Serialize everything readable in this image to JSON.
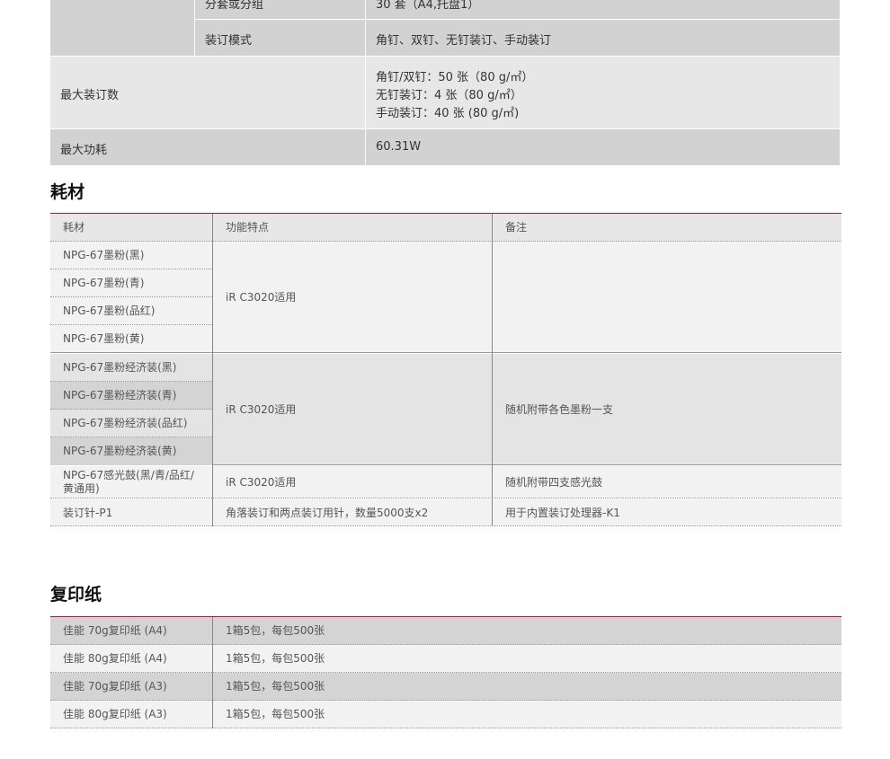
{
  "spec_table": {
    "rows": [
      {
        "sub_label": "分套或分组",
        "value": "30 套（A4,托盘1）"
      },
      {
        "sub_label": "装订模式",
        "value": "角钉、双钉、无钉装订、手动装订"
      },
      {
        "label": "最大装订数",
        "values": [
          "角钉/双钉：50 张（80 g/㎡）",
          "无钉装订：4 张（80 g/㎡）",
          "手动装订：40 张 (80 g/㎡)"
        ]
      },
      {
        "label": "最大功耗",
        "value": "60.31W"
      }
    ]
  },
  "consumables": {
    "title": "耗材",
    "headers": [
      "耗材",
      "功能特点",
      "备注"
    ],
    "group1": {
      "items": [
        "NPG-67墨粉(黑)",
        "NPG-67墨粉(青)",
        "NPG-67墨粉(品红)",
        "NPG-67墨粉(黄)"
      ],
      "feature": "iR C3020适用",
      "note": ""
    },
    "group2": {
      "items": [
        "NPG-67墨粉经济装(黑)",
        "NPG-67墨粉经济装(青)",
        "NPG-67墨粉经济装(品红)",
        "NPG-67墨粉经济装(黄)"
      ],
      "feature": "iR C3020适用",
      "note": "随机附带各色墨粉一支"
    },
    "drum": {
      "item_line1": "NPG-67感光鼓(黑/青/品红/",
      "item_line2": "黄通用)",
      "feature": "iR C3020适用",
      "note": "随机附带四支感光鼓"
    },
    "staple": {
      "item": "装订针-P1",
      "feature": "角落装订和两点装订用针，数量5000支x2",
      "note": "用于内置装订处理器-K1"
    }
  },
  "paper": {
    "title": "复印纸",
    "rows": [
      {
        "name": "佳能 70g复印纸 (A4)",
        "desc": "1箱5包，每包500张"
      },
      {
        "name": "佳能 80g复印纸 (A4)",
        "desc": "1箱5包，每包500张"
      },
      {
        "name": "佳能 70g复印纸 (A3)",
        "desc": "1箱5包，每包500张"
      },
      {
        "name": "佳能 80g复印纸 (A3)",
        "desc": "1箱5包，每包500张"
      }
    ]
  }
}
